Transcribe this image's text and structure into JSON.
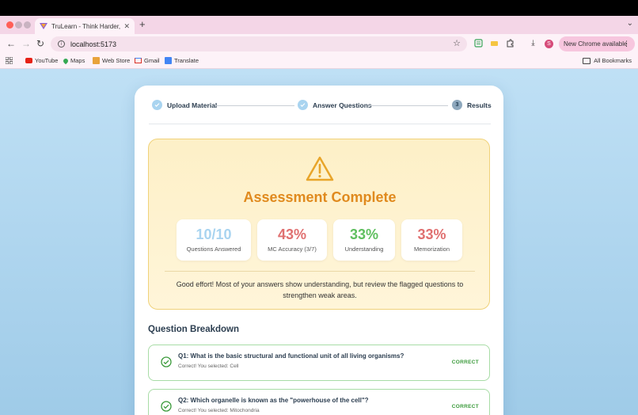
{
  "browser": {
    "tab_title": "TruLearn - Think Harder, Lea",
    "url": "localhost:5173",
    "update_label": "New Chrome available",
    "avatar_initial": "S",
    "bookmarks": [
      "YouTube",
      "Maps",
      "Web Store",
      "Gmail",
      "Translate"
    ],
    "all_bookmarks": "All Bookmarks"
  },
  "stepper": {
    "steps": [
      {
        "label": "Upload Material",
        "state": "done"
      },
      {
        "label": "Answer Questions",
        "state": "done"
      },
      {
        "label": "Results",
        "number": "3",
        "state": "current"
      }
    ]
  },
  "assessment": {
    "title": "Assessment Complete",
    "stats": [
      {
        "value": "10/10",
        "label": "Questions Answered",
        "color": "#a9d4f0"
      },
      {
        "value": "43%",
        "label": "MC Accuracy (3/7)",
        "color": "#e07070"
      },
      {
        "value": "33%",
        "label": "Understanding",
        "color": "#5fbf5f"
      },
      {
        "value": "33%",
        "label": "Memorization",
        "color": "#e07070"
      }
    ],
    "message": "Good effort! Most of your answers show understanding, but review the flagged questions to strengthen weak areas."
  },
  "breakdown": {
    "title": "Question Breakdown",
    "questions": [
      {
        "text": "Q1: What is the basic structural and functional unit of all living organisms?",
        "sub": "Correct! You selected: Cell",
        "status": "CORRECT"
      },
      {
        "text": "Q2: Which organelle is known as the \"powerhouse of the cell\"?",
        "sub": "Correct! You selected: Mitochondria",
        "status": "CORRECT"
      }
    ]
  },
  "colors": {
    "accent_orange": "#e08a1e",
    "correct_green": "#3a9a3a"
  }
}
